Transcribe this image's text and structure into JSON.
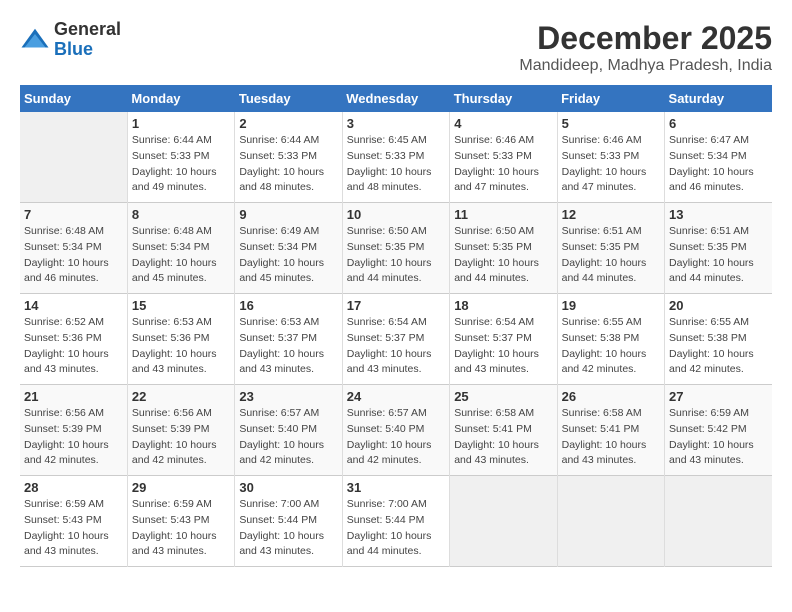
{
  "logo": {
    "general": "General",
    "blue": "Blue"
  },
  "title": {
    "month": "December 2025",
    "location": "Mandideep, Madhya Pradesh, India"
  },
  "days_of_week": [
    "Sunday",
    "Monday",
    "Tuesday",
    "Wednesday",
    "Thursday",
    "Friday",
    "Saturday"
  ],
  "weeks": [
    [
      {
        "day": "",
        "info": ""
      },
      {
        "day": "1",
        "info": "Sunrise: 6:44 AM\nSunset: 5:33 PM\nDaylight: 10 hours\nand 49 minutes."
      },
      {
        "day": "2",
        "info": "Sunrise: 6:44 AM\nSunset: 5:33 PM\nDaylight: 10 hours\nand 48 minutes."
      },
      {
        "day": "3",
        "info": "Sunrise: 6:45 AM\nSunset: 5:33 PM\nDaylight: 10 hours\nand 48 minutes."
      },
      {
        "day": "4",
        "info": "Sunrise: 6:46 AM\nSunset: 5:33 PM\nDaylight: 10 hours\nand 47 minutes."
      },
      {
        "day": "5",
        "info": "Sunrise: 6:46 AM\nSunset: 5:33 PM\nDaylight: 10 hours\nand 47 minutes."
      },
      {
        "day": "6",
        "info": "Sunrise: 6:47 AM\nSunset: 5:34 PM\nDaylight: 10 hours\nand 46 minutes."
      }
    ],
    [
      {
        "day": "7",
        "info": "Sunrise: 6:48 AM\nSunset: 5:34 PM\nDaylight: 10 hours\nand 46 minutes."
      },
      {
        "day": "8",
        "info": "Sunrise: 6:48 AM\nSunset: 5:34 PM\nDaylight: 10 hours\nand 45 minutes."
      },
      {
        "day": "9",
        "info": "Sunrise: 6:49 AM\nSunset: 5:34 PM\nDaylight: 10 hours\nand 45 minutes."
      },
      {
        "day": "10",
        "info": "Sunrise: 6:50 AM\nSunset: 5:35 PM\nDaylight: 10 hours\nand 44 minutes."
      },
      {
        "day": "11",
        "info": "Sunrise: 6:50 AM\nSunset: 5:35 PM\nDaylight: 10 hours\nand 44 minutes."
      },
      {
        "day": "12",
        "info": "Sunrise: 6:51 AM\nSunset: 5:35 PM\nDaylight: 10 hours\nand 44 minutes."
      },
      {
        "day": "13",
        "info": "Sunrise: 6:51 AM\nSunset: 5:35 PM\nDaylight: 10 hours\nand 44 minutes."
      }
    ],
    [
      {
        "day": "14",
        "info": "Sunrise: 6:52 AM\nSunset: 5:36 PM\nDaylight: 10 hours\nand 43 minutes."
      },
      {
        "day": "15",
        "info": "Sunrise: 6:53 AM\nSunset: 5:36 PM\nDaylight: 10 hours\nand 43 minutes."
      },
      {
        "day": "16",
        "info": "Sunrise: 6:53 AM\nSunset: 5:37 PM\nDaylight: 10 hours\nand 43 minutes."
      },
      {
        "day": "17",
        "info": "Sunrise: 6:54 AM\nSunset: 5:37 PM\nDaylight: 10 hours\nand 43 minutes."
      },
      {
        "day": "18",
        "info": "Sunrise: 6:54 AM\nSunset: 5:37 PM\nDaylight: 10 hours\nand 43 minutes."
      },
      {
        "day": "19",
        "info": "Sunrise: 6:55 AM\nSunset: 5:38 PM\nDaylight: 10 hours\nand 42 minutes."
      },
      {
        "day": "20",
        "info": "Sunrise: 6:55 AM\nSunset: 5:38 PM\nDaylight: 10 hours\nand 42 minutes."
      }
    ],
    [
      {
        "day": "21",
        "info": "Sunrise: 6:56 AM\nSunset: 5:39 PM\nDaylight: 10 hours\nand 42 minutes."
      },
      {
        "day": "22",
        "info": "Sunrise: 6:56 AM\nSunset: 5:39 PM\nDaylight: 10 hours\nand 42 minutes."
      },
      {
        "day": "23",
        "info": "Sunrise: 6:57 AM\nSunset: 5:40 PM\nDaylight: 10 hours\nand 42 minutes."
      },
      {
        "day": "24",
        "info": "Sunrise: 6:57 AM\nSunset: 5:40 PM\nDaylight: 10 hours\nand 42 minutes."
      },
      {
        "day": "25",
        "info": "Sunrise: 6:58 AM\nSunset: 5:41 PM\nDaylight: 10 hours\nand 43 minutes."
      },
      {
        "day": "26",
        "info": "Sunrise: 6:58 AM\nSunset: 5:41 PM\nDaylight: 10 hours\nand 43 minutes."
      },
      {
        "day": "27",
        "info": "Sunrise: 6:59 AM\nSunset: 5:42 PM\nDaylight: 10 hours\nand 43 minutes."
      }
    ],
    [
      {
        "day": "28",
        "info": "Sunrise: 6:59 AM\nSunset: 5:43 PM\nDaylight: 10 hours\nand 43 minutes."
      },
      {
        "day": "29",
        "info": "Sunrise: 6:59 AM\nSunset: 5:43 PM\nDaylight: 10 hours\nand 43 minutes."
      },
      {
        "day": "30",
        "info": "Sunrise: 7:00 AM\nSunset: 5:44 PM\nDaylight: 10 hours\nand 43 minutes."
      },
      {
        "day": "31",
        "info": "Sunrise: 7:00 AM\nSunset: 5:44 PM\nDaylight: 10 hours\nand 44 minutes."
      },
      {
        "day": "",
        "info": ""
      },
      {
        "day": "",
        "info": ""
      },
      {
        "day": "",
        "info": ""
      }
    ]
  ]
}
